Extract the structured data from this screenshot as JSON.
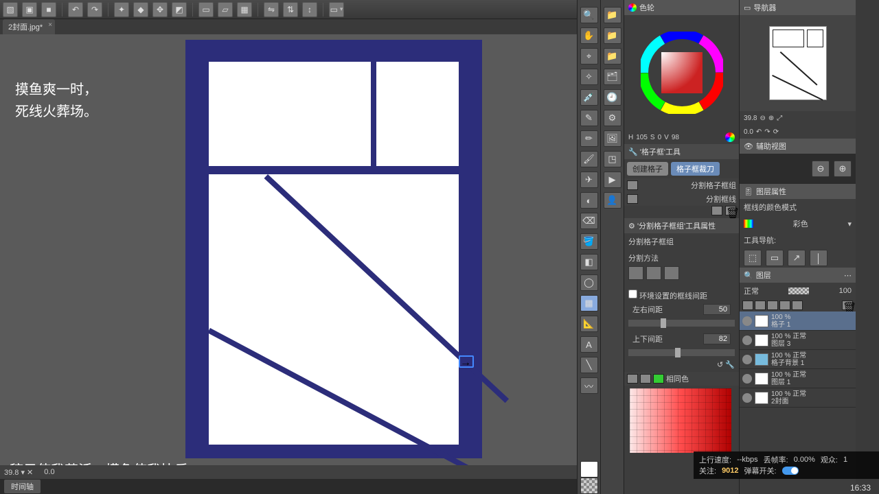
{
  "doc_tab": "2封面.jpg*",
  "overlay": {
    "line1": "摸鱼爽一时，",
    "line2": "死线火葬场。",
    "caption": "稿子使我苟活，摸鱼使我快乐"
  },
  "status": {
    "zoom": "39.8",
    "angle": "0.0"
  },
  "footer_tab": "时间轴",
  "color_panel": {
    "title": "色轮",
    "h_label": "H",
    "h_val": "105",
    "s_label": "S",
    "s_val": "0",
    "v_label": "V",
    "v_val": "98"
  },
  "subtool": {
    "title": "'格子框'工具",
    "btn_create": "创建格子",
    "btn_crop": "格子框裁刀",
    "opt1": "分割格子框组",
    "opt2": "分割框线"
  },
  "tool_prop": {
    "title": "'分割格子框组'工具属性",
    "header": "分割格子框组",
    "method_label": "分割方法",
    "env_label": "环境设置的框线间距",
    "left_label": "左右间距",
    "left_val": "50",
    "top_label": "上下间距",
    "top_val": "82",
    "same_color": "相同色"
  },
  "nav": {
    "title": "导航器",
    "zoom": "39.8",
    "angle": "0.0"
  },
  "quick_access": {
    "title": "辅助视图"
  },
  "layer_panel": {
    "title": "图层属性",
    "mode_label": "框线的颜色模式",
    "mode_value": "彩色",
    "tool_label": "工具导航:",
    "search_label": "图层",
    "blend": "正常",
    "opacity": "100",
    "layers": [
      {
        "name": "格子 1",
        "opacity": "100 %"
      },
      {
        "name": "图层 3",
        "info": "100 %  正常"
      },
      {
        "name": "格子背景 1",
        "info": "100 %  正常"
      },
      {
        "name": "图层 1",
        "info": "100 %  正常"
      },
      {
        "name": "2封面",
        "info": "100 %  正常"
      }
    ]
  },
  "stream": {
    "up_label": "上行速度:",
    "up_val": "--kbps",
    "drop_label": "丢帧率:",
    "drop_val": "0.00%",
    "view_label": "观众:",
    "view_val": "1",
    "follow_label": "关注:",
    "follow_val": "9012",
    "danmu_label": "弹幕开关:"
  },
  "clock": "16:33"
}
